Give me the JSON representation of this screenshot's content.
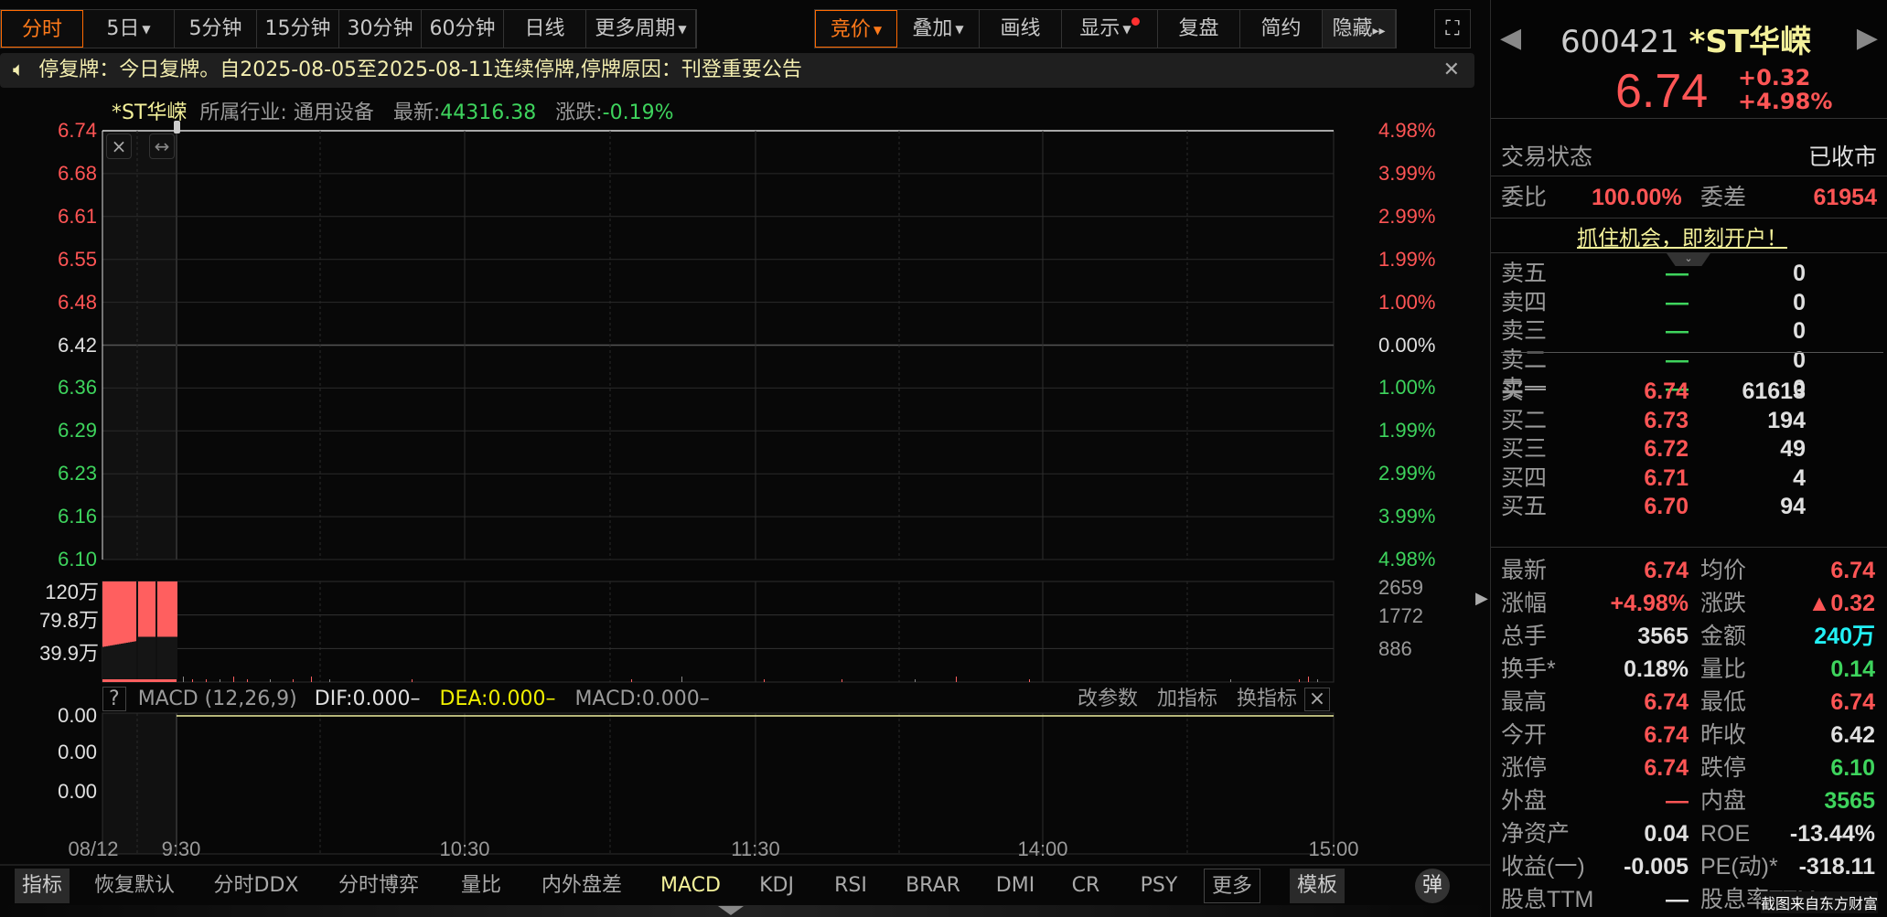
{
  "toolbar": {
    "periods": [
      "分时",
      "5日",
      "5分钟",
      "15分钟",
      "30分钟",
      "60分钟",
      "日线",
      "更多周期"
    ],
    "tools": [
      "竞价",
      "叠加",
      "画线",
      "显示",
      "复盘",
      "简约",
      "隐藏"
    ],
    "active_period": "分时",
    "active_tool": "竞价"
  },
  "notice": {
    "icon": "speaker-icon",
    "text": "停复牌：今日复牌。自2025-08-05至2025-08-11连续停牌,停牌原因：刊登重要公告"
  },
  "info": {
    "name": "*ST华嵘",
    "industry_label": "所属行业:",
    "industry": "通用设备",
    "latest_label": "最新:",
    "latest": "44316.38",
    "change_label": "涨跌:",
    "change": "-0.19%"
  },
  "price_axis": {
    "left": [
      "6.74",
      "6.68",
      "6.61",
      "6.55",
      "6.48",
      "6.42",
      "6.36",
      "6.29",
      "6.23",
      "6.16",
      "6.10"
    ],
    "right": [
      "4.98%",
      "3.99%",
      "2.99%",
      "1.99%",
      "1.00%",
      "0.00%",
      "1.00%",
      "1.99%",
      "2.99%",
      "3.99%",
      "4.98%"
    ],
    "prev_close": "6.42"
  },
  "volume_axis": {
    "left": [
      "120万",
      "79.8万",
      "39.9万"
    ],
    "right": [
      "2659",
      "1772",
      "886"
    ]
  },
  "macd": {
    "help": "?",
    "title": "MACD (12,26,9)",
    "dif": "DIF:0.000–",
    "dea": "DEA:0.000–",
    "macd": "MACD:0.000–",
    "actions": [
      "改参数",
      "加指标",
      "换指标"
    ],
    "axis": [
      "0.00",
      "0.00",
      "0.00"
    ]
  },
  "time_axis": [
    "08/12",
    "9:30",
    "10:30",
    "11:30",
    "14:00",
    "15:00"
  ],
  "bottom_tabs": [
    "指标",
    "恢复默认",
    "分时DDX",
    "分时博弈",
    "量比",
    "内外盘差",
    "MACD",
    "KDJ",
    "RSI",
    "BRAR",
    "DMI",
    "CR",
    "PSY",
    "更多",
    "模板",
    "弹"
  ],
  "quote": {
    "code": "600421",
    "name": "*ST华嵘",
    "price": "6.74",
    "change": "+0.32",
    "change_pct": "+4.98%",
    "status_label": "交易状态",
    "status": "已收市",
    "wb_label": "委比",
    "wb": "100.00%",
    "wc_label": "委差",
    "wc": "61954",
    "promo": "抓住机会，即刻开户！",
    "sell": [
      {
        "l": "卖五",
        "p": "—",
        "v": "0"
      },
      {
        "l": "卖四",
        "p": "—",
        "v": "0"
      },
      {
        "l": "卖三",
        "p": "—",
        "v": "0"
      },
      {
        "l": "卖二",
        "p": "—",
        "v": "0"
      },
      {
        "l": "卖一",
        "p": "—",
        "v": "0"
      }
    ],
    "buy": [
      {
        "l": "买一",
        "p": "6.74",
        "v": "61613"
      },
      {
        "l": "买二",
        "p": "6.73",
        "v": "194"
      },
      {
        "l": "买三",
        "p": "6.72",
        "v": "49"
      },
      {
        "l": "买四",
        "p": "6.71",
        "v": "4"
      },
      {
        "l": "买五",
        "p": "6.70",
        "v": "94"
      }
    ],
    "stats": [
      {
        "l1": "最新",
        "v1": "6.74",
        "c1": "red",
        "l2": "均价",
        "v2": "6.74",
        "c2": "red"
      },
      {
        "l1": "涨幅",
        "v1": "+4.98%",
        "c1": "red",
        "l2": "涨跌",
        "v2": "▲0.32",
        "c2": "red"
      },
      {
        "l1": "总手",
        "v1": "3565",
        "c1": "wht",
        "l2": "金额",
        "v2": "240万",
        "c2": "cyan"
      },
      {
        "l1": "换手*",
        "v1": "0.18%",
        "c1": "wht",
        "l2": "量比",
        "v2": "0.14",
        "c2": "grn"
      },
      {
        "l1": "最高",
        "v1": "6.74",
        "c1": "red",
        "l2": "最低",
        "v2": "6.74",
        "c2": "red"
      },
      {
        "l1": "今开",
        "v1": "6.74",
        "c1": "red",
        "l2": "昨收",
        "v2": "6.42",
        "c2": "wht"
      },
      {
        "l1": "涨停",
        "v1": "6.74",
        "c1": "red",
        "l2": "跌停",
        "v2": "6.10",
        "c2": "grn"
      },
      {
        "l1": "外盘",
        "v1": "—",
        "c1": "red",
        "l2": "内盘",
        "v2": "3565",
        "c2": "grn"
      },
      {
        "l1": "净资产",
        "v1": "0.04",
        "c1": "wht",
        "l2": "ROE",
        "v2": "-13.44%",
        "c2": "wht"
      },
      {
        "l1": "收益(一)",
        "v1": "-0.005",
        "c1": "wht",
        "l2": "PE(动)*",
        "v2": "-318.11",
        "c2": "wht"
      },
      {
        "l1": "股息TTM",
        "v1": "—",
        "c1": "wht",
        "l2": "股息率TTM",
        "v2": "",
        "c2": "wht"
      }
    ]
  },
  "watermark": "截图来自东方财富",
  "colors": {
    "up": "#ff5555",
    "down": "#3ed45d",
    "accent": "#ff6a00",
    "yellow": "#f4f19a"
  }
}
